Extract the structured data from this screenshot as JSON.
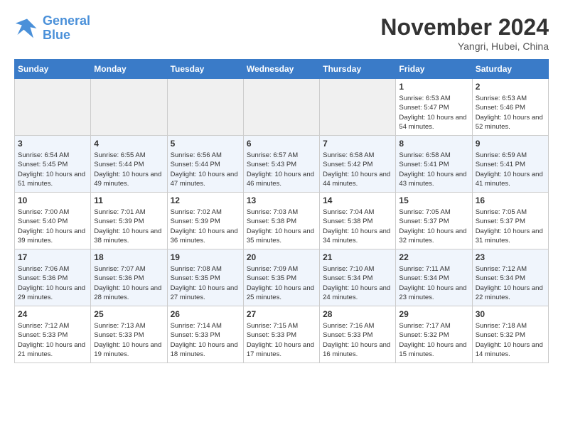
{
  "header": {
    "logo_line1": "General",
    "logo_line2": "Blue",
    "month_title": "November 2024",
    "location": "Yangri, Hubei, China"
  },
  "days_of_week": [
    "Sunday",
    "Monday",
    "Tuesday",
    "Wednesday",
    "Thursday",
    "Friday",
    "Saturday"
  ],
  "weeks": [
    [
      {
        "day": "",
        "empty": true
      },
      {
        "day": "",
        "empty": true
      },
      {
        "day": "",
        "empty": true
      },
      {
        "day": "",
        "empty": true
      },
      {
        "day": "",
        "empty": true
      },
      {
        "day": "1",
        "sunrise": "Sunrise: 6:53 AM",
        "sunset": "Sunset: 5:47 PM",
        "daylight": "Daylight: 10 hours and 54 minutes."
      },
      {
        "day": "2",
        "sunrise": "Sunrise: 6:53 AM",
        "sunset": "Sunset: 5:46 PM",
        "daylight": "Daylight: 10 hours and 52 minutes."
      }
    ],
    [
      {
        "day": "3",
        "sunrise": "Sunrise: 6:54 AM",
        "sunset": "Sunset: 5:45 PM",
        "daylight": "Daylight: 10 hours and 51 minutes."
      },
      {
        "day": "4",
        "sunrise": "Sunrise: 6:55 AM",
        "sunset": "Sunset: 5:44 PM",
        "daylight": "Daylight: 10 hours and 49 minutes."
      },
      {
        "day": "5",
        "sunrise": "Sunrise: 6:56 AM",
        "sunset": "Sunset: 5:44 PM",
        "daylight": "Daylight: 10 hours and 47 minutes."
      },
      {
        "day": "6",
        "sunrise": "Sunrise: 6:57 AM",
        "sunset": "Sunset: 5:43 PM",
        "daylight": "Daylight: 10 hours and 46 minutes."
      },
      {
        "day": "7",
        "sunrise": "Sunrise: 6:58 AM",
        "sunset": "Sunset: 5:42 PM",
        "daylight": "Daylight: 10 hours and 44 minutes."
      },
      {
        "day": "8",
        "sunrise": "Sunrise: 6:58 AM",
        "sunset": "Sunset: 5:41 PM",
        "daylight": "Daylight: 10 hours and 43 minutes."
      },
      {
        "day": "9",
        "sunrise": "Sunrise: 6:59 AM",
        "sunset": "Sunset: 5:41 PM",
        "daylight": "Daylight: 10 hours and 41 minutes."
      }
    ],
    [
      {
        "day": "10",
        "sunrise": "Sunrise: 7:00 AM",
        "sunset": "Sunset: 5:40 PM",
        "daylight": "Daylight: 10 hours and 39 minutes."
      },
      {
        "day": "11",
        "sunrise": "Sunrise: 7:01 AM",
        "sunset": "Sunset: 5:39 PM",
        "daylight": "Daylight: 10 hours and 38 minutes."
      },
      {
        "day": "12",
        "sunrise": "Sunrise: 7:02 AM",
        "sunset": "Sunset: 5:39 PM",
        "daylight": "Daylight: 10 hours and 36 minutes."
      },
      {
        "day": "13",
        "sunrise": "Sunrise: 7:03 AM",
        "sunset": "Sunset: 5:38 PM",
        "daylight": "Daylight: 10 hours and 35 minutes."
      },
      {
        "day": "14",
        "sunrise": "Sunrise: 7:04 AM",
        "sunset": "Sunset: 5:38 PM",
        "daylight": "Daylight: 10 hours and 34 minutes."
      },
      {
        "day": "15",
        "sunrise": "Sunrise: 7:05 AM",
        "sunset": "Sunset: 5:37 PM",
        "daylight": "Daylight: 10 hours and 32 minutes."
      },
      {
        "day": "16",
        "sunrise": "Sunrise: 7:05 AM",
        "sunset": "Sunset: 5:37 PM",
        "daylight": "Daylight: 10 hours and 31 minutes."
      }
    ],
    [
      {
        "day": "17",
        "sunrise": "Sunrise: 7:06 AM",
        "sunset": "Sunset: 5:36 PM",
        "daylight": "Daylight: 10 hours and 29 minutes."
      },
      {
        "day": "18",
        "sunrise": "Sunrise: 7:07 AM",
        "sunset": "Sunset: 5:36 PM",
        "daylight": "Daylight: 10 hours and 28 minutes."
      },
      {
        "day": "19",
        "sunrise": "Sunrise: 7:08 AM",
        "sunset": "Sunset: 5:35 PM",
        "daylight": "Daylight: 10 hours and 27 minutes."
      },
      {
        "day": "20",
        "sunrise": "Sunrise: 7:09 AM",
        "sunset": "Sunset: 5:35 PM",
        "daylight": "Daylight: 10 hours and 25 minutes."
      },
      {
        "day": "21",
        "sunrise": "Sunrise: 7:10 AM",
        "sunset": "Sunset: 5:34 PM",
        "daylight": "Daylight: 10 hours and 24 minutes."
      },
      {
        "day": "22",
        "sunrise": "Sunrise: 7:11 AM",
        "sunset": "Sunset: 5:34 PM",
        "daylight": "Daylight: 10 hours and 23 minutes."
      },
      {
        "day": "23",
        "sunrise": "Sunrise: 7:12 AM",
        "sunset": "Sunset: 5:34 PM",
        "daylight": "Daylight: 10 hours and 22 minutes."
      }
    ],
    [
      {
        "day": "24",
        "sunrise": "Sunrise: 7:12 AM",
        "sunset": "Sunset: 5:33 PM",
        "daylight": "Daylight: 10 hours and 21 minutes."
      },
      {
        "day": "25",
        "sunrise": "Sunrise: 7:13 AM",
        "sunset": "Sunset: 5:33 PM",
        "daylight": "Daylight: 10 hours and 19 minutes."
      },
      {
        "day": "26",
        "sunrise": "Sunrise: 7:14 AM",
        "sunset": "Sunset: 5:33 PM",
        "daylight": "Daylight: 10 hours and 18 minutes."
      },
      {
        "day": "27",
        "sunrise": "Sunrise: 7:15 AM",
        "sunset": "Sunset: 5:33 PM",
        "daylight": "Daylight: 10 hours and 17 minutes."
      },
      {
        "day": "28",
        "sunrise": "Sunrise: 7:16 AM",
        "sunset": "Sunset: 5:33 PM",
        "daylight": "Daylight: 10 hours and 16 minutes."
      },
      {
        "day": "29",
        "sunrise": "Sunrise: 7:17 AM",
        "sunset": "Sunset: 5:32 PM",
        "daylight": "Daylight: 10 hours and 15 minutes."
      },
      {
        "day": "30",
        "sunrise": "Sunrise: 7:18 AM",
        "sunset": "Sunset: 5:32 PM",
        "daylight": "Daylight: 10 hours and 14 minutes."
      }
    ]
  ]
}
